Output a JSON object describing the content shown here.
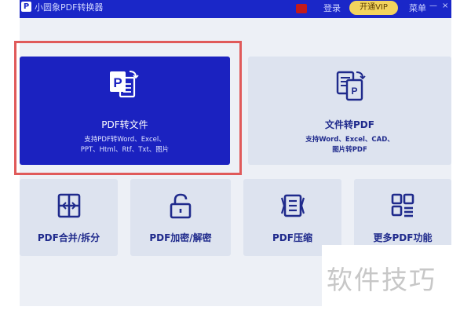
{
  "titlebar": {
    "app_title": "小圆象PDF转换器",
    "login": "登录",
    "vip": "开通VIP",
    "menu": "菜单",
    "minimize": "—",
    "close": "×"
  },
  "cards": {
    "pdf_to_file": {
      "label": "PDF转文件",
      "desc_line1": "支持PDF转Word、Excel、",
      "desc_line2": "PPT、Html、Rtf、Txt、图片",
      "icon": "pdf-file-icon"
    },
    "file_to_pdf": {
      "label": "文件转PDF",
      "desc_line1": "支持Word、Excel、CAD、",
      "desc_line2": "图片转PDF",
      "icon": "file-convert-icon"
    },
    "merge_split": {
      "label": "PDF合并/拆分",
      "icon": "merge-split-icon"
    },
    "encrypt": {
      "label": "PDF加密/解密",
      "icon": "lock-icon"
    },
    "compress": {
      "label": "PDF压缩",
      "icon": "compress-icon"
    },
    "more": {
      "label": "更多PDF功能",
      "icon": "grid-more-icon"
    }
  },
  "watermark": "软件技巧",
  "colors": {
    "brand": "#1a27c8",
    "selected_card": "#1b22c0",
    "card_bg": "#dde3ef",
    "highlight": "#e05a5a"
  }
}
